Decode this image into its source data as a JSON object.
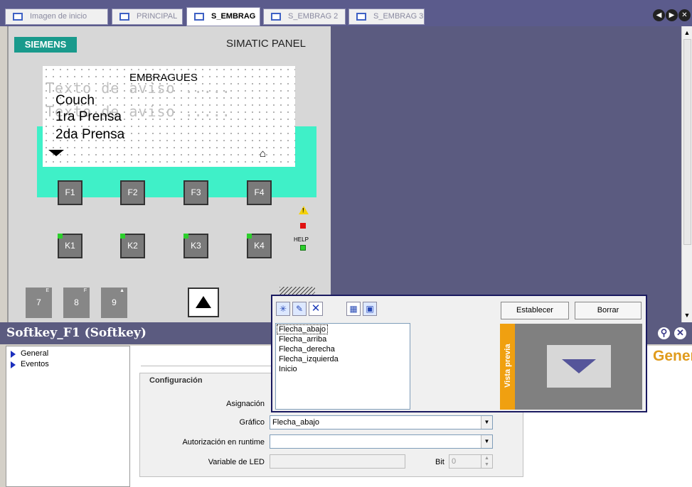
{
  "tabs": [
    {
      "label": "Imagen de inicio",
      "active": false
    },
    {
      "label": "PRINCIPAL",
      "active": false
    },
    {
      "label": "S_EMBRAG",
      "active": true
    },
    {
      "label": "S_EMBRAG 2",
      "active": false
    },
    {
      "label": "S_EMBRAG 3",
      "active": false
    }
  ],
  "panel": {
    "brand": "SIEMENS",
    "model": "SIMATIC PANEL",
    "screen_title": "EMBRAGUES",
    "ghost_text_1": "Texto de aviso .....",
    "ghost_text_2": "Texto de aviso .....",
    "menu": [
      "Couch",
      "1ra Prensa",
      "2da Prensa"
    ],
    "fkeys": [
      "F1",
      "F2",
      "F3",
      "F4"
    ],
    "kkeys": [
      "K1",
      "K2",
      "K3",
      "K4"
    ],
    "numkeys": [
      {
        "label": "7",
        "sup": "E"
      },
      {
        "label": "8",
        "sup": "F"
      },
      {
        "label": "9",
        "sup": ""
      }
    ],
    "help_label": "HELP"
  },
  "properties": {
    "title": "Softkey_F1 (Softkey)",
    "tree": [
      "General",
      "Eventos"
    ],
    "section_heading": "General",
    "group_label": "Configuración",
    "fields": {
      "asignacion_label": "Asignación",
      "grafico_label": "Gráfico",
      "grafico_value": "Flecha_abajo",
      "autorizacion_label": "Autorización en runtime",
      "autorizacion_value": "",
      "led_label": "Variable de LED",
      "led_value": "",
      "bit_label": "Bit",
      "bit_value": "0"
    }
  },
  "popup": {
    "btn_set": "Establecer",
    "btn_clear": "Borrar",
    "list": [
      "Flecha_abajo",
      "Flecha_arriba",
      "Flecha_derecha",
      "Flecha_izquierda",
      "Inicio"
    ],
    "selected": "Flecha_abajo",
    "preview_label": "Vista previa"
  },
  "icons": [
    "tab-screen-icon",
    "nav-prev-icon",
    "nav-next-icon",
    "close-icon",
    "pin-icon",
    "warning-icon",
    "down-arrow-icon",
    "home-icon",
    "up-arrow-icon",
    "tree-arrow-icon",
    "add-graphic-icon",
    "edit-graphic-icon",
    "delete-icon",
    "view-list-icon",
    "view-grid-icon"
  ],
  "colors": {
    "accent": "#5b5b80",
    "teal": "#3ff0c8",
    "brand": "#199a8c",
    "highlight": "#e09b1c"
  }
}
